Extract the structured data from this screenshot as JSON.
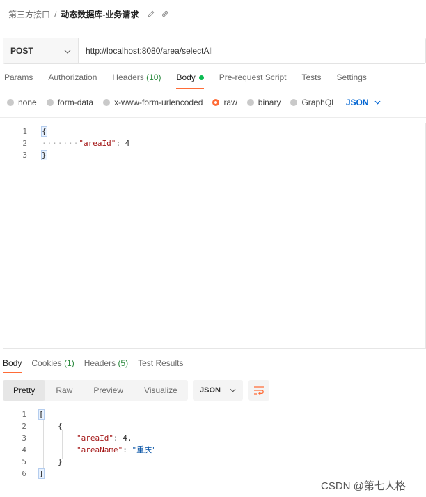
{
  "breadcrumb": {
    "parent": "第三方接口",
    "separator": "/",
    "current": "动态数据库-业务请求"
  },
  "request": {
    "method": "POST",
    "url": "http://localhost:8080/area/selectAll"
  },
  "tabs": [
    {
      "label": "Params"
    },
    {
      "label": "Authorization"
    },
    {
      "label": "Headers",
      "count": "(10)"
    },
    {
      "label": "Body",
      "active": true
    },
    {
      "label": "Pre-request Script"
    },
    {
      "label": "Tests"
    },
    {
      "label": "Settings"
    }
  ],
  "body_types": [
    "none",
    "form-data",
    "x-www-form-urlencoded",
    "raw",
    "binary",
    "GraphQL"
  ],
  "body_format": "JSON",
  "request_body": {
    "line_numbers": [
      "1",
      "2",
      "3"
    ],
    "open": "{",
    "key": "\"areaId\"",
    "colon": ": ",
    "value": "4",
    "close": "}"
  },
  "response_tabs": [
    {
      "label": "Body"
    },
    {
      "label": "Cookies",
      "count": "(1)"
    },
    {
      "label": "Headers",
      "count": "(5)"
    },
    {
      "label": "Test Results"
    }
  ],
  "view_modes": [
    "Pretty",
    "Raw",
    "Preview",
    "Visualize"
  ],
  "response_format": "JSON",
  "response_body": {
    "line_numbers": [
      "1",
      "2",
      "3",
      "4",
      "5",
      "6"
    ],
    "l1": "[",
    "l2": "{",
    "k1": "\"areaId\"",
    "v1": "4",
    "k2": "\"areaName\"",
    "v2": "\"重庆\"",
    "l5": "}",
    "l6": "]"
  },
  "watermark": "CSDN @第七人格",
  "colors": {
    "accent": "#ff6c37",
    "green": "#0cbb52",
    "link_blue": "#0265d2"
  }
}
